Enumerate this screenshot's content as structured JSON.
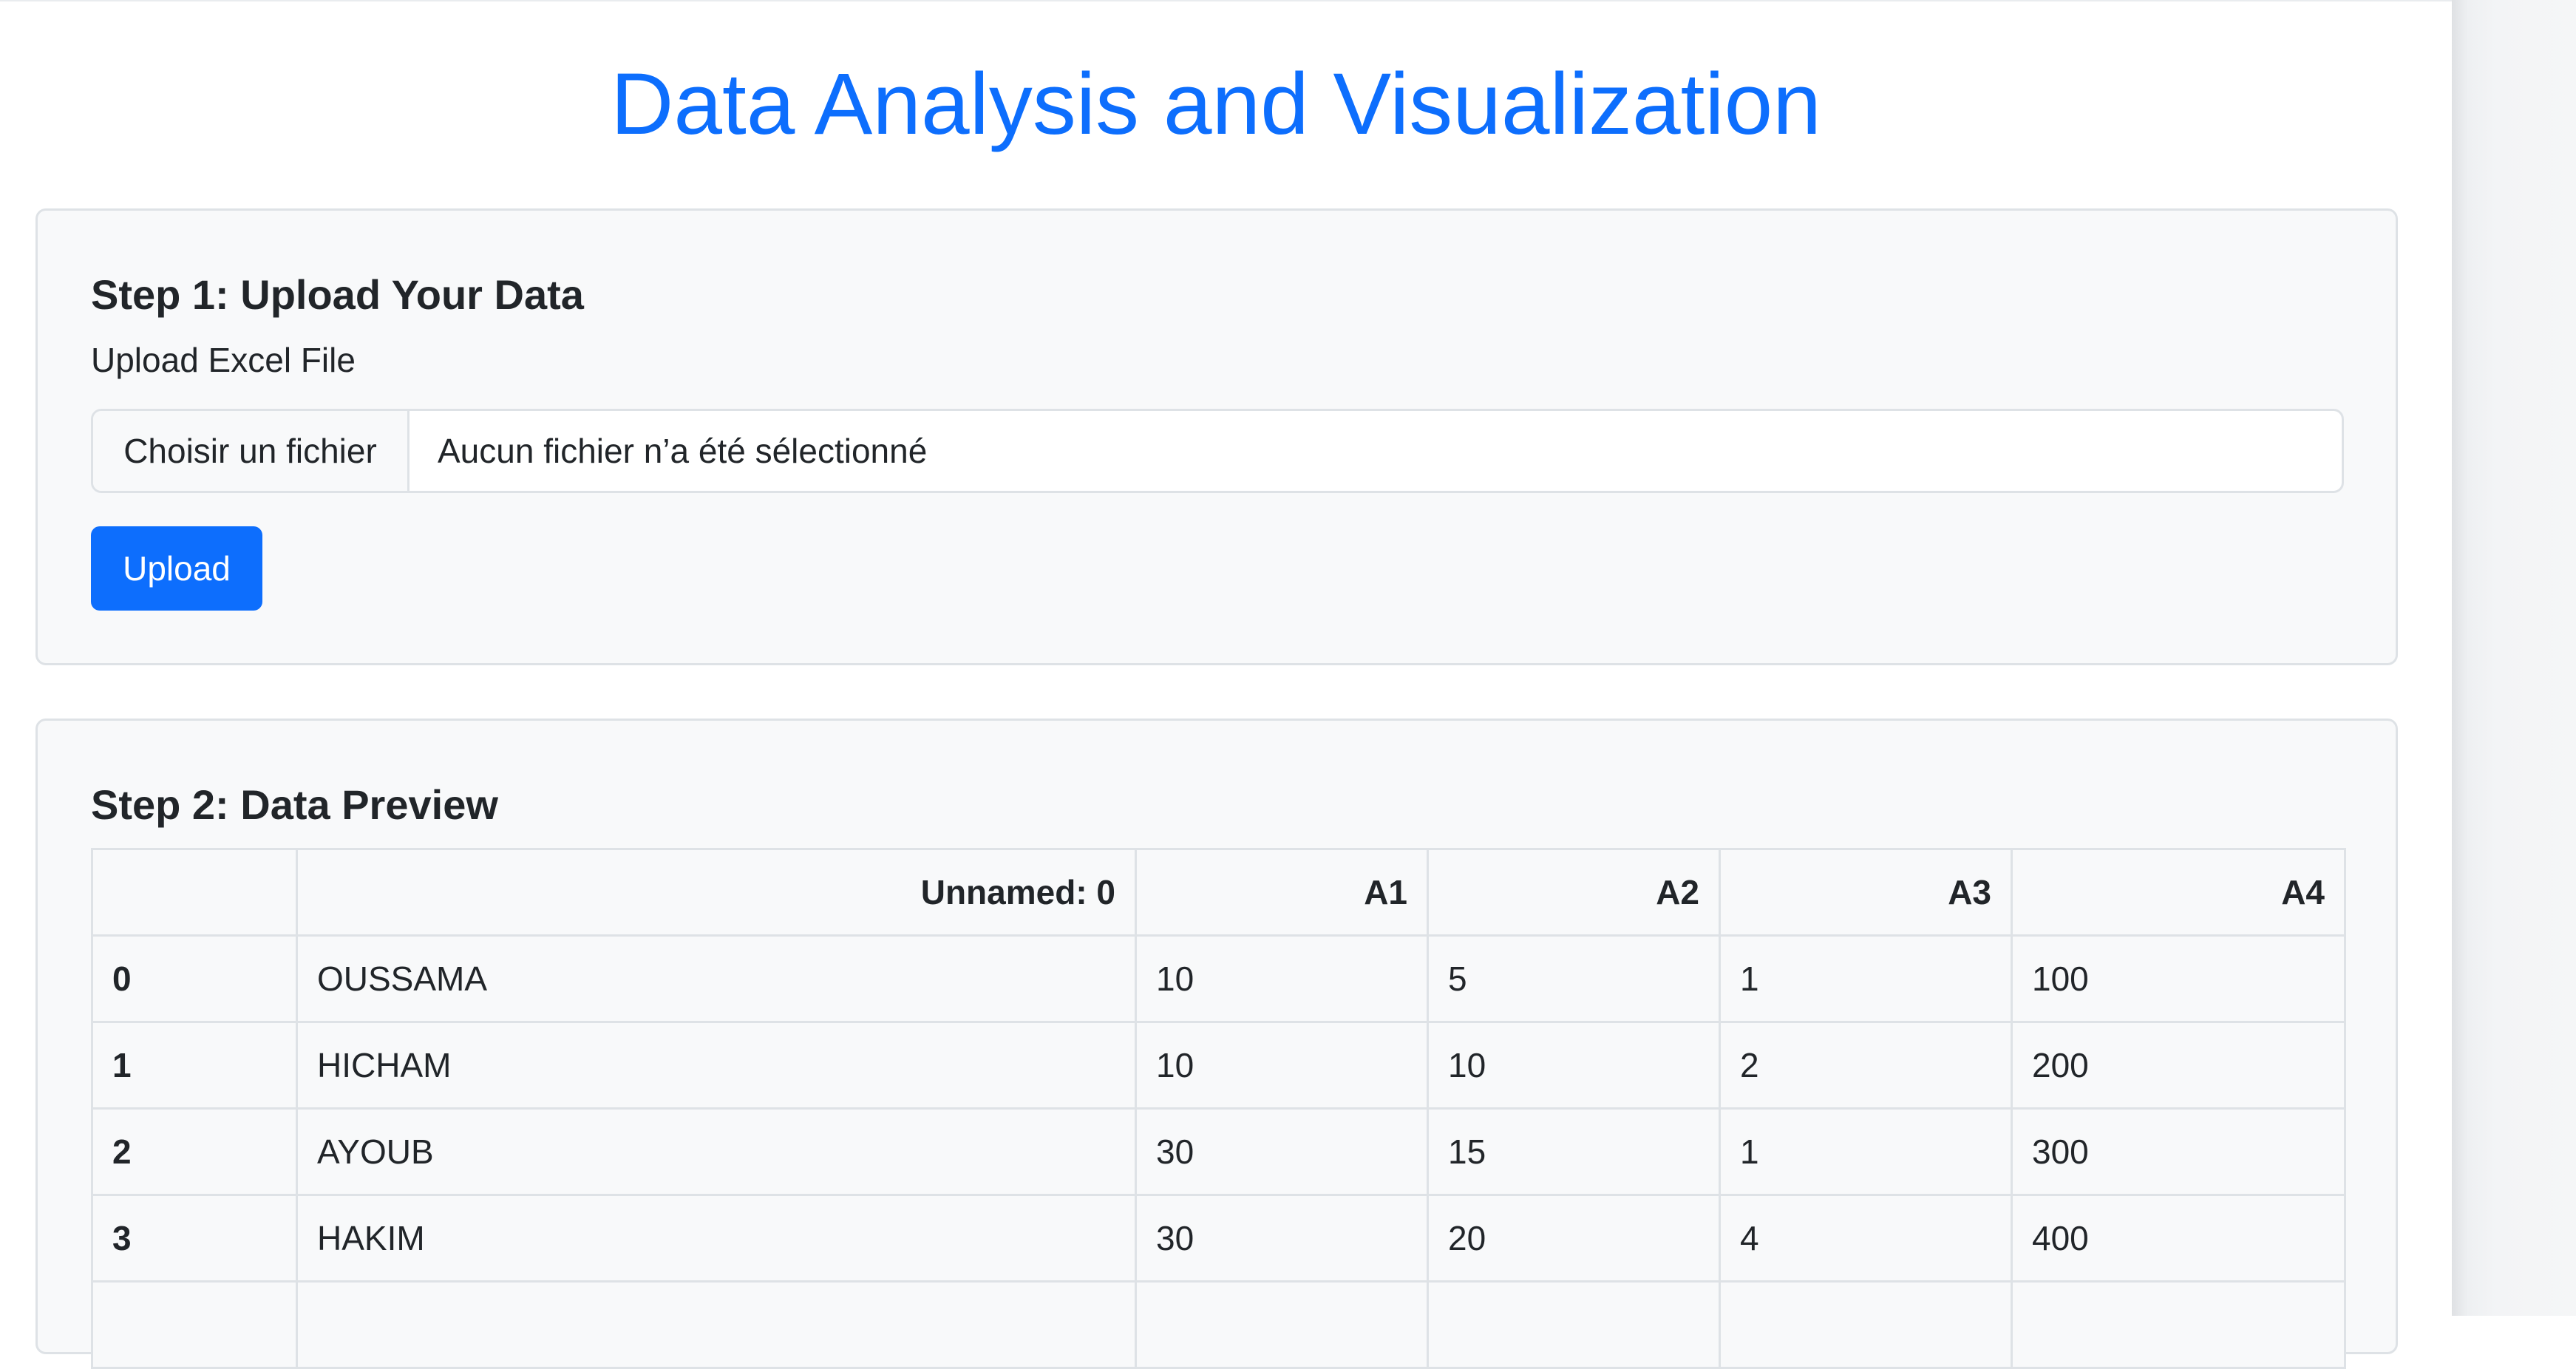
{
  "header": {
    "title": "Data Analysis and Visualization"
  },
  "step1": {
    "heading": "Step 1: Upload Your Data",
    "label": "Upload Excel File",
    "file_button_label": "Choisir un fichier",
    "file_status": "Aucun fichier n’a été sélectionné",
    "upload_label": "Upload"
  },
  "step2": {
    "heading": "Step 2: Data Preview",
    "table": {
      "columns": [
        "",
        "Unnamed: 0",
        "A1",
        "A2",
        "A3",
        "A4"
      ],
      "rows": [
        [
          "0",
          "OUSSAMA",
          "10",
          "5",
          "1",
          "100"
        ],
        [
          "1",
          "HICHAM",
          "10",
          "10",
          "2",
          "200"
        ],
        [
          "2",
          "AYOUB",
          "30",
          "15",
          "1",
          "300"
        ],
        [
          "3",
          "HAKIM",
          "30",
          "20",
          "4",
          "400"
        ],
        [
          "",
          "",
          "",
          "",
          "",
          ""
        ]
      ]
    }
  },
  "colors": {
    "primary": "#0d6efd",
    "card_background": "#f8f9fa",
    "border": "#dee2e6",
    "text": "#212529"
  }
}
